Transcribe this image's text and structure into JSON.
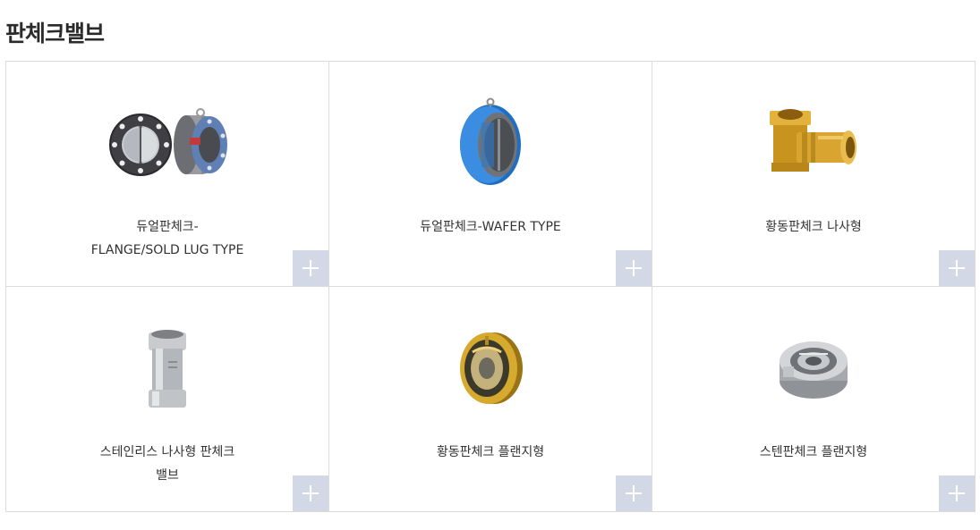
{
  "page": {
    "title": "판체크밸브"
  },
  "products": [
    {
      "lines": [
        "듀얼판체크-",
        "FLANGE/SOLD LUG TYPE"
      ],
      "icon": "dual-check-flange-image"
    },
    {
      "lines": [
        "듀얼판체크-WAFER TYPE"
      ],
      "icon": "dual-check-wafer-image"
    },
    {
      "lines": [
        "황동판체크 나사형"
      ],
      "icon": "brass-threaded-check-image"
    },
    {
      "lines": [
        "스테인리스 나사형 판체크",
        "밸브"
      ],
      "icon": "stainless-threaded-check-image"
    },
    {
      "lines": [
        "황동판체크 플랜지형"
      ],
      "icon": "brass-flange-check-image"
    },
    {
      "lines": [
        "스텐판체크 플랜지형"
      ],
      "icon": "stainless-flange-check-image"
    }
  ],
  "more_button": {
    "icon": "plus-icon",
    "color": "#d3d8e6"
  }
}
